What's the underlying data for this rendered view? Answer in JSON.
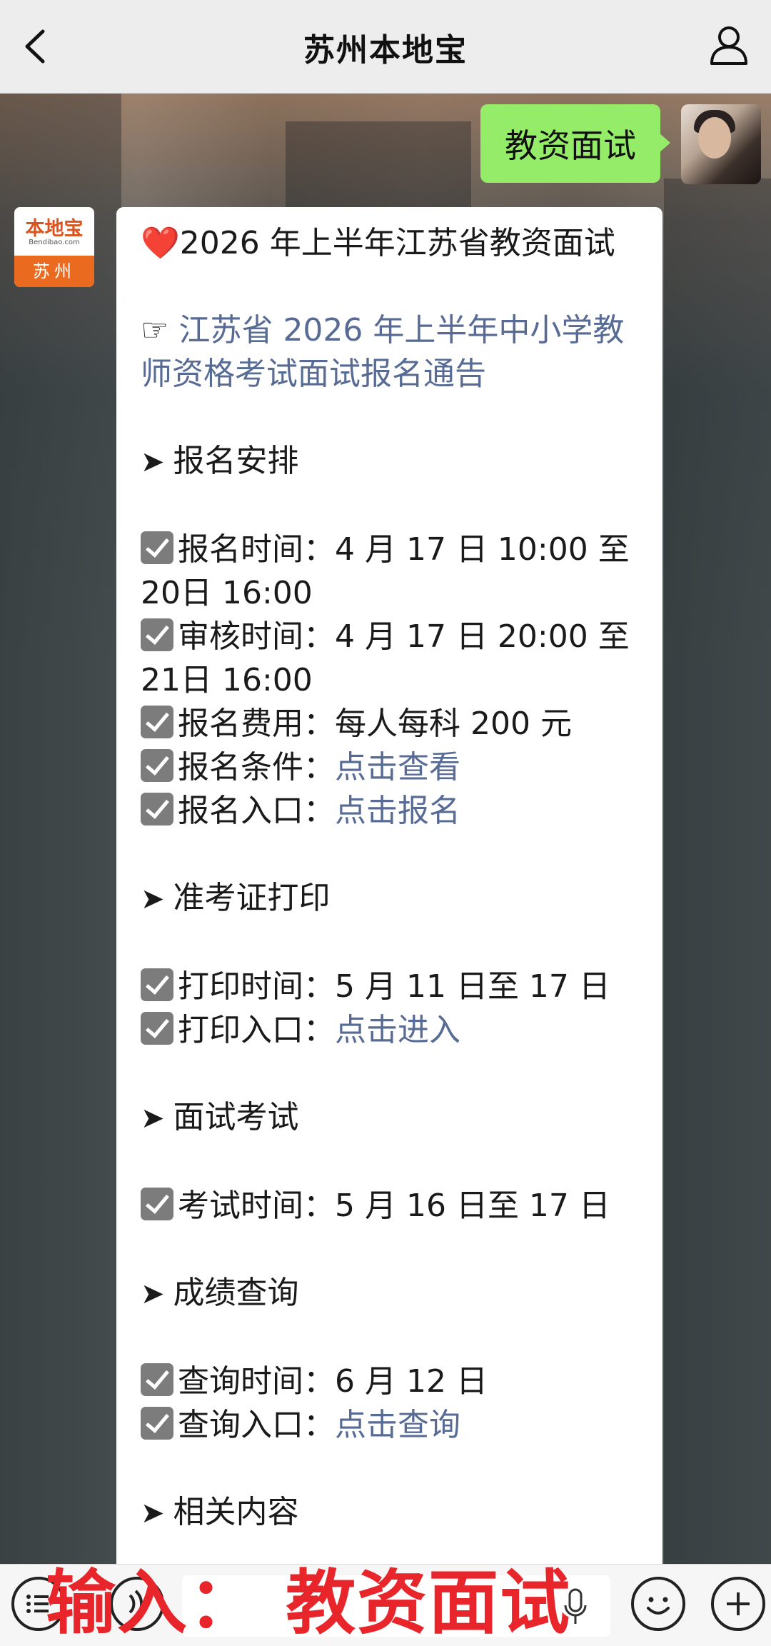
{
  "header": {
    "title": "苏州本地宝",
    "back_icon": "chevron-left-icon",
    "profile_icon": "person-icon"
  },
  "user_message": {
    "text": "教资面试"
  },
  "bot": {
    "logo_top": "本地宝",
    "logo_url": "Bendibao.com",
    "logo_bottom": "苏州"
  },
  "message": {
    "title_heart": "❤️",
    "title": "2026 年上半年江苏省教资面试",
    "notice_hand": "☞",
    "notice_link": "江苏省 2026 年上半年中小学教师资格考试面试报名通告",
    "arrow": "➤",
    "sec1_title": "报名安排",
    "sec1_items": [
      {
        "label": "报名时间：",
        "value": "4 月 17 日 10:00 至 20日 16:00"
      },
      {
        "label": "审核时间：",
        "value": "4 月 17 日 20:00 至 21日 16:00"
      },
      {
        "label": "报名费用：",
        "value": "每人每科 200 元"
      },
      {
        "label": "报名条件：",
        "link": "点击查看"
      },
      {
        "label": "报名入口：",
        "link": "点击报名"
      }
    ],
    "sec2_title": "准考证打印",
    "sec2_items": [
      {
        "label": "打印时间：",
        "value": "5 月 11 日至 17 日"
      },
      {
        "label": "打印入口：",
        "link": "点击进入"
      }
    ],
    "sec3_title": "面试考试",
    "sec3_items": [
      {
        "label": "考试时间：",
        "value": "5 月 16 日至 17 日"
      }
    ],
    "sec4_title": "成绩查询",
    "sec4_items": [
      {
        "label": "查询时间：",
        "value": "6 月 12 日"
      },
      {
        "label": "查询入口：",
        "link": "点击查询"
      }
    ],
    "sec5_title": "相关内容"
  },
  "bottom": {
    "overlay": "输入：  教资面试",
    "icons": [
      "menu-icon",
      "voice-icon",
      "mic-icon",
      "emoji-icon",
      "plus-icon"
    ]
  },
  "colors": {
    "accent_green": "#95ec69",
    "link_blue": "#576b95",
    "overlay_red": "#e8252a"
  }
}
